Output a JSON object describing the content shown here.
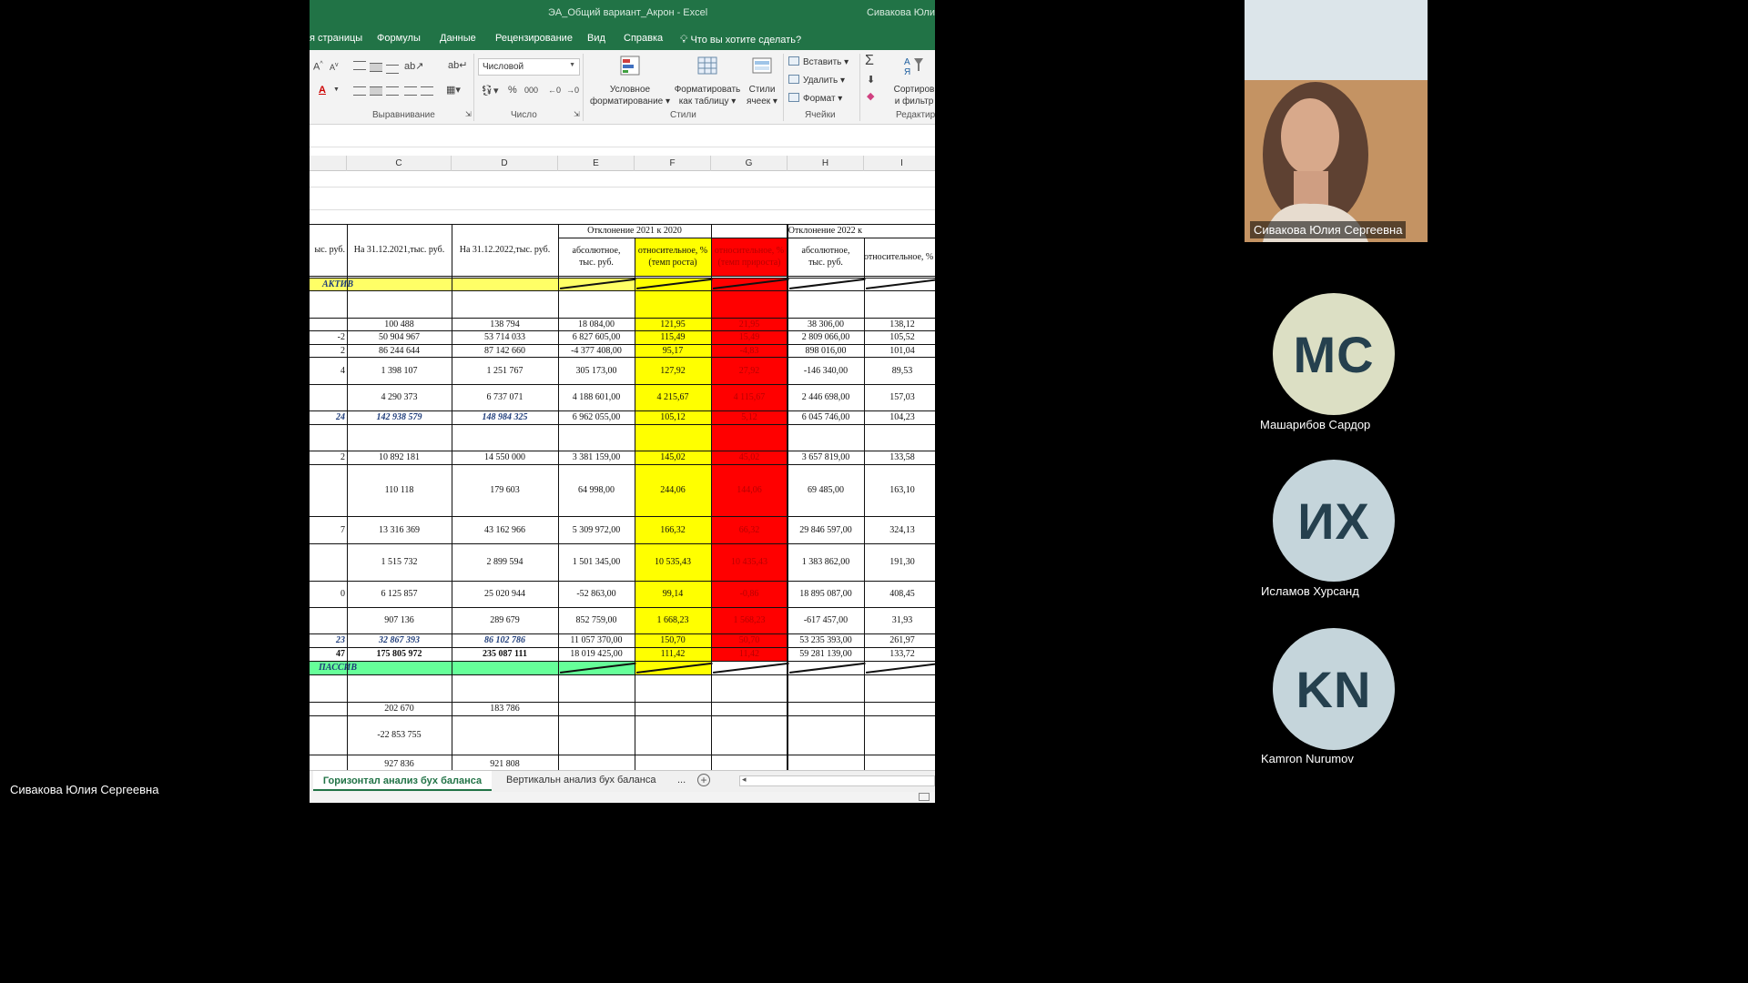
{
  "excel": {
    "title": "ЭА_Общий вариант_Акрон  -  Excel",
    "user": "Сивакова Юли",
    "menu": [
      "я страницы",
      "Формулы",
      "Данные",
      "Рецензирование",
      "Вид",
      "Справка",
      "Что вы хотите сделать?"
    ],
    "ribbon": {
      "number_format": "Числовой",
      "groups": [
        "Выравнивание",
        "Число",
        "Стили",
        "Ячейки",
        "Редактир"
      ],
      "cond_format": [
        "Условное",
        "форматирование"
      ],
      "format_table": [
        "Форматировать",
        "как таблицу"
      ],
      "cell_styles": [
        "Стили",
        "ячеек"
      ],
      "insert": "Вставить",
      "delete": "Удалить",
      "format": "Формат",
      "sort": [
        "Сортиров",
        "и фильтр"
      ]
    },
    "columns": [
      "C",
      "D",
      "E",
      "F",
      "G",
      "H",
      "I"
    ],
    "headers": {
      "b": "ыс. руб.",
      "c": "На 31.12.2021,тыс. руб.",
      "d": "На 31.12.2022,тыс. руб.",
      "dev2021": "Отклонение 2021 к 2020",
      "dev2022": "Отклонение 2022 к",
      "abs": "абсолютное, тыс. руб.",
      "rel": "относительное, % (темп роста)",
      "relg": "относительное, % (темп прироста)"
    },
    "aktiv": "АКТИВ",
    "passiv": "ПАССИВ",
    "rows": [
      {
        "b": "",
        "c": "100 488",
        "d": "138 794",
        "e": "18 084,00",
        "f": "121,95",
        "g": "21,95",
        "h": "38 306,00",
        "i": "138,12"
      },
      {
        "b": "-2",
        "c": "50 904 967",
        "d": "53 714 033",
        "e": "6 827 605,00",
        "f": "115,49",
        "g": "15,49",
        "h": "2 809 066,00",
        "i": "105,52"
      },
      {
        "b": "2",
        "c": "86 244 644",
        "d": "87 142 660",
        "e": "-4 377 408,00",
        "f": "95,17",
        "g": "-4,83",
        "h": "898 016,00",
        "i": "101,04"
      },
      {
        "b": "4",
        "c": "1 398 107",
        "d": "1 251 767",
        "e": "305 173,00",
        "f": "127,92",
        "g": "27,92",
        "h": "-146 340,00",
        "i": "89,53"
      },
      {
        "b": "",
        "c": "4 290 373",
        "d": "6 737 071",
        "e": "4 188 601,00",
        "f": "4 215,67",
        "g": "4 115,67",
        "h": "2 446 698,00",
        "i": "157,03"
      },
      {
        "b": "24",
        "c": "142 938 579",
        "d": "148 984 325",
        "e": "6 962 055,00",
        "f": "105,12",
        "g": "5,12",
        "h": "6 045 746,00",
        "i": "104,23"
      },
      {
        "b": "",
        "c": "",
        "d": "",
        "e": "",
        "f": "",
        "g": "",
        "h": "",
        "i": ""
      },
      {
        "b": "2",
        "c": "10 892 181",
        "d": "14 550 000",
        "e": "3 381 159,00",
        "f": "145,02",
        "g": "45,02",
        "h": "3 657 819,00",
        "i": "133,58"
      },
      {
        "b": "",
        "c": "110 118",
        "d": "179 603",
        "e": "64 998,00",
        "f": "244,06",
        "g": "144,06",
        "h": "69 485,00",
        "i": "163,10"
      },
      {
        "b": "7",
        "c": "13 316 369",
        "d": "43 162 966",
        "e": "5 309 972,00",
        "f": "166,32",
        "g": "66,32",
        "h": "29 846 597,00",
        "i": "324,13"
      },
      {
        "b": "",
        "c": "1 515 732",
        "d": "2 899 594",
        "e": "1 501 345,00",
        "f": "10 535,43",
        "g": "10 435,43",
        "h": "1 383 862,00",
        "i": "191,30"
      },
      {
        "b": "0",
        "c": "6 125 857",
        "d": "25 020 944",
        "e": "-52 863,00",
        "f": "99,14",
        "g": "-0,86",
        "h": "18 895 087,00",
        "i": "408,45"
      },
      {
        "b": "",
        "c": "907 136",
        "d": "289 679",
        "e": "852 759,00",
        "f": "1 668,23",
        "g": "1 568,23",
        "h": "-617 457,00",
        "i": "31,93"
      },
      {
        "b": "23",
        "c": "32 867 393",
        "d": "86 102 786",
        "e": "11 057 370,00",
        "f": "150,70",
        "g": "50,70",
        "h": "53 235 393,00",
        "i": "261,97"
      },
      {
        "b": "47",
        "c": "175 805 972",
        "d": "235 087 111",
        "e": "18 019 425,00",
        "f": "111,42",
        "g": "11,42",
        "h": "59 281 139,00",
        "i": "133,72"
      }
    ],
    "passiv_rows": [
      {
        "c": "",
        "d": ""
      },
      {
        "c": "202 670",
        "d": "183 786"
      },
      {
        "c": "-22 853 755",
        "d": ""
      },
      {
        "c": "927 836",
        "d": "921 808"
      }
    ],
    "sheets": [
      "Горизонтал анализ бух баланса",
      "Вертикальн анализ бух баланса",
      "..."
    ]
  },
  "meeting": {
    "presenter": "Сивакова Юлия Сергеевна",
    "participants": [
      {
        "initials": "МС",
        "name": "Машарибов Сардор",
        "color": "#dcdfc4"
      },
      {
        "initials": "ИХ",
        "name": "Исламов Хурсанд",
        "color": "#c5d5db"
      },
      {
        "initials": "KN",
        "name": "Kamron Nurumov",
        "color": "#c5d5db"
      }
    ]
  }
}
